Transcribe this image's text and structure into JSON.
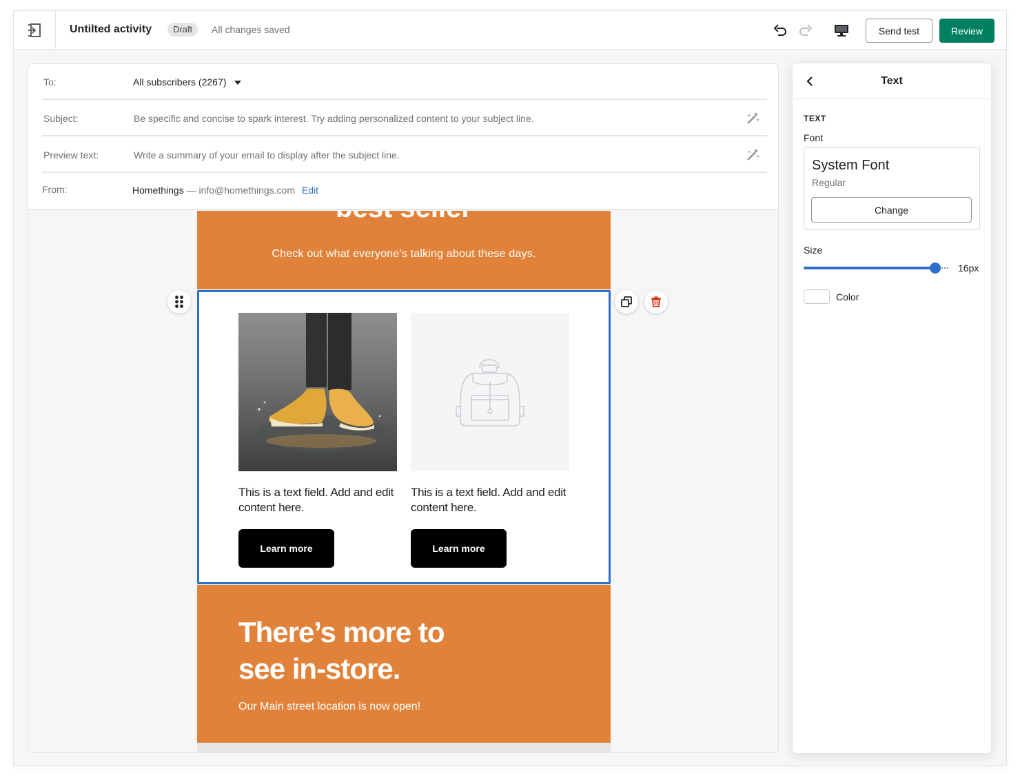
{
  "topbar": {
    "title": "Untilted activity",
    "badge": "Draft",
    "status": "All changes saved",
    "send_test_label": "Send test",
    "review_label": "Review"
  },
  "meta": {
    "to_label": "To:",
    "to_value": "All subscribers (2267)",
    "subject_label": "Subject:",
    "subject_placeholder": "Be specific and concise to spark interest. Try adding personalized content to your subject line.",
    "preview_label": "Preview text:",
    "preview_placeholder": "Write a summary of your email to display after the subject line.",
    "from_label": "From:",
    "from_name": "Homethings",
    "from_sep": " — ",
    "from_email": "info@homethings.com",
    "edit_label": "Edit"
  },
  "email": {
    "hero_title": "best seller",
    "hero_subtitle": "Check out what everyone's talking about these days.",
    "products": [
      {
        "text": "This is a text field. Add and edit content here.",
        "button": "Learn more"
      },
      {
        "text": "This is a text field. Add and edit content here.",
        "button": "Learn more"
      }
    ],
    "promo_title": "There’s more to see in-store.",
    "promo_subtitle": "Our Main street location is now open!"
  },
  "panel": {
    "title": "Text",
    "section": "TEXT",
    "font_label": "Font",
    "font_name": "System Font",
    "font_style": "Regular",
    "change_label": "Change",
    "size_label": "Size",
    "size_value": "16px",
    "color_label": "Color"
  },
  "colors": {
    "accent_green": "#008060",
    "selection_blue": "#2c6ecb",
    "email_orange": "#e1823a"
  }
}
